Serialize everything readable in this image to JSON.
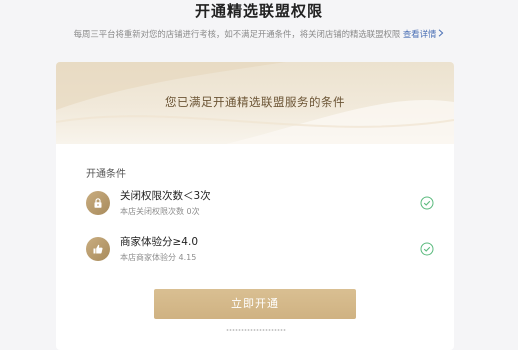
{
  "header": {
    "title": "开通精选联盟权限",
    "description": "每周三平台将重新对您的店铺进行考核，如不满足开通条件，将关闭店铺的精选联盟权限",
    "link_label": "查看详情",
    "link_icon": "chevron-right-icon",
    "link_color": "#4a6fb5"
  },
  "banner": {
    "text": "您已满足开通精选联盟服务的条件"
  },
  "conditions": {
    "section_label": "开通条件",
    "items": [
      {
        "name": "关闭权限次数＜3次",
        "detail": "本店关闭权限次数 0次",
        "icon": "lock-icon",
        "met": true
      },
      {
        "name": "商家体验分≥4.0",
        "detail": "本店商家体验分 4.15",
        "icon": "thumbs-up-icon",
        "met": true
      }
    ]
  },
  "action": {
    "button_label": "立即开通"
  },
  "colors": {
    "accent_gold": "#cfb282",
    "check_green": "#5aba7d"
  }
}
